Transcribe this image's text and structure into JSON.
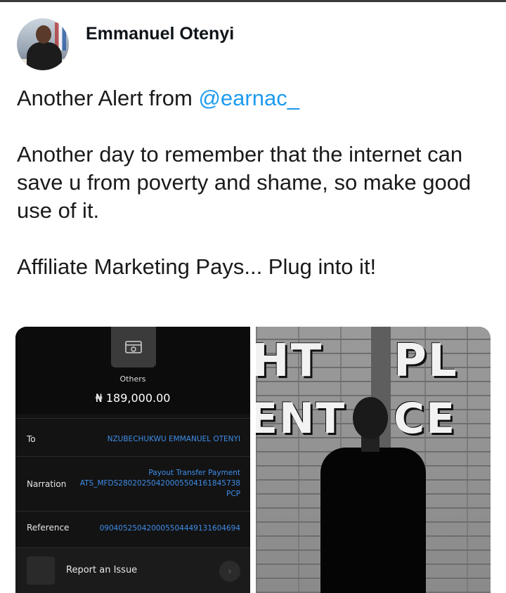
{
  "author": {
    "name": "Emmanuel Otenyi",
    "avatar_icon": "profile-photo"
  },
  "tweet": {
    "line1_prefix": "Another Alert from ",
    "mention": "@earnac_",
    "para2": "Another day to remember that the internet can save u from poverty and shame, so make good use of it.",
    "para3": "Affiliate Marketing Pays... Plug into it!"
  },
  "receipt": {
    "category": "Others",
    "amount": "₦ 189,000.00",
    "to_label": "To",
    "to_value": "NZUBECHUKWU EMMANUEL OTENYI",
    "narration_label": "Narration",
    "narration_value": "Payout Transfer Payment ATS_MFDS280202504200055041618457​38 PCP",
    "reference_label": "Reference",
    "reference_value": "090405250420005504449131604694",
    "report_label": "Report an Issue"
  },
  "photo": {
    "sign_left_top": "HT",
    "sign_right_top": "PL",
    "sign_left_bottom": "ENT",
    "sign_right_bottom": "CE"
  },
  "colors": {
    "mention": "#1d9bf0",
    "receipt_link": "#3f8de8",
    "receipt_bg": "#131313"
  }
}
